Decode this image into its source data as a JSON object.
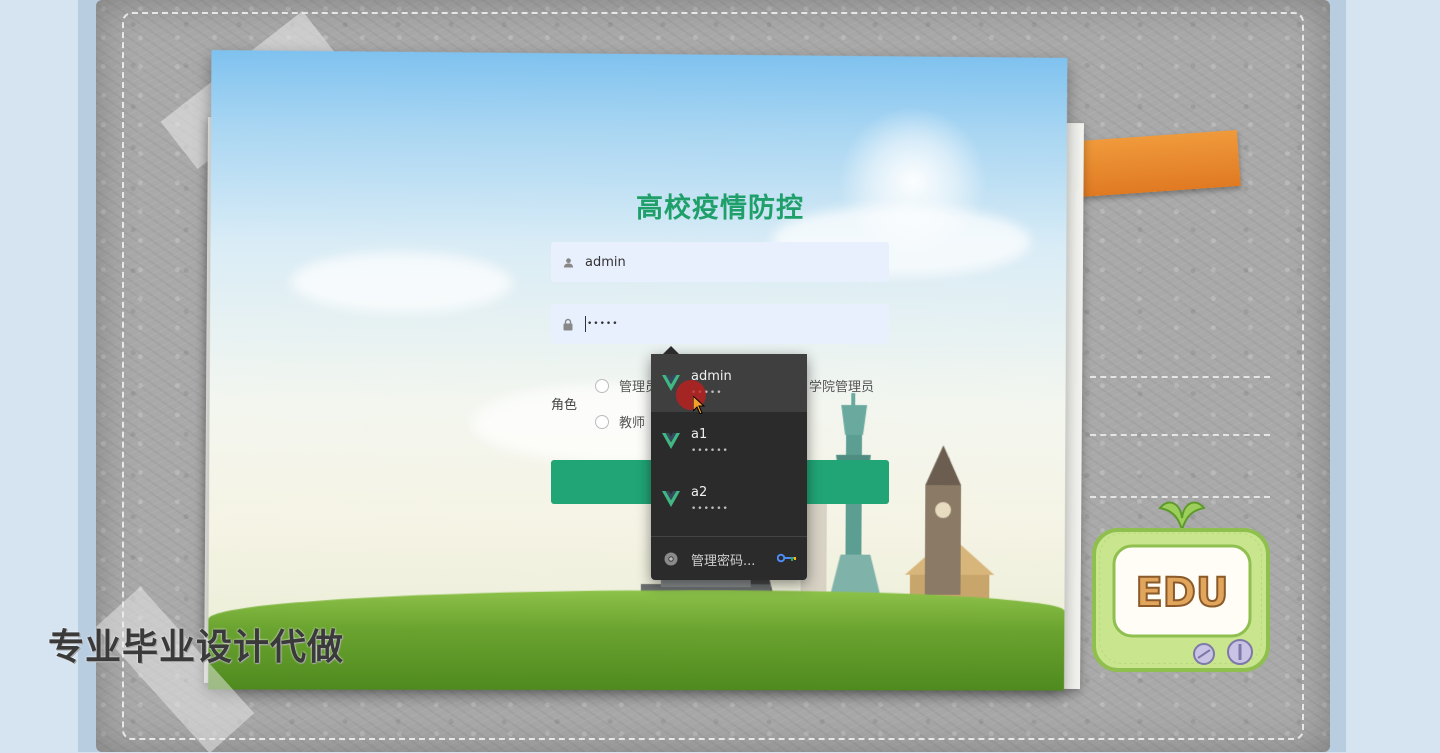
{
  "app": {
    "title": "高校疫情防控"
  },
  "login": {
    "username_value": "admin",
    "password_mask": "•••••",
    "role_label": "角色",
    "role_options": [
      "管理员",
      "学院管理员",
      "教师"
    ],
    "submit_label": ""
  },
  "autofill": {
    "items": [
      {
        "user": "admin",
        "mask": "•••••"
      },
      {
        "user": "a1",
        "mask": "••••••"
      },
      {
        "user": "a2",
        "mask": "••••••"
      }
    ],
    "manage_label": "管理密码..."
  },
  "overlay": {
    "watermark": "专业毕业设计代做",
    "badge": "EDU"
  },
  "colors": {
    "accent": "#21a577",
    "title": "#1fa06a",
    "input_bg": "#e8f0fe",
    "dropdown_bg": "#2b2b2b",
    "vue_green": "#41b883"
  }
}
